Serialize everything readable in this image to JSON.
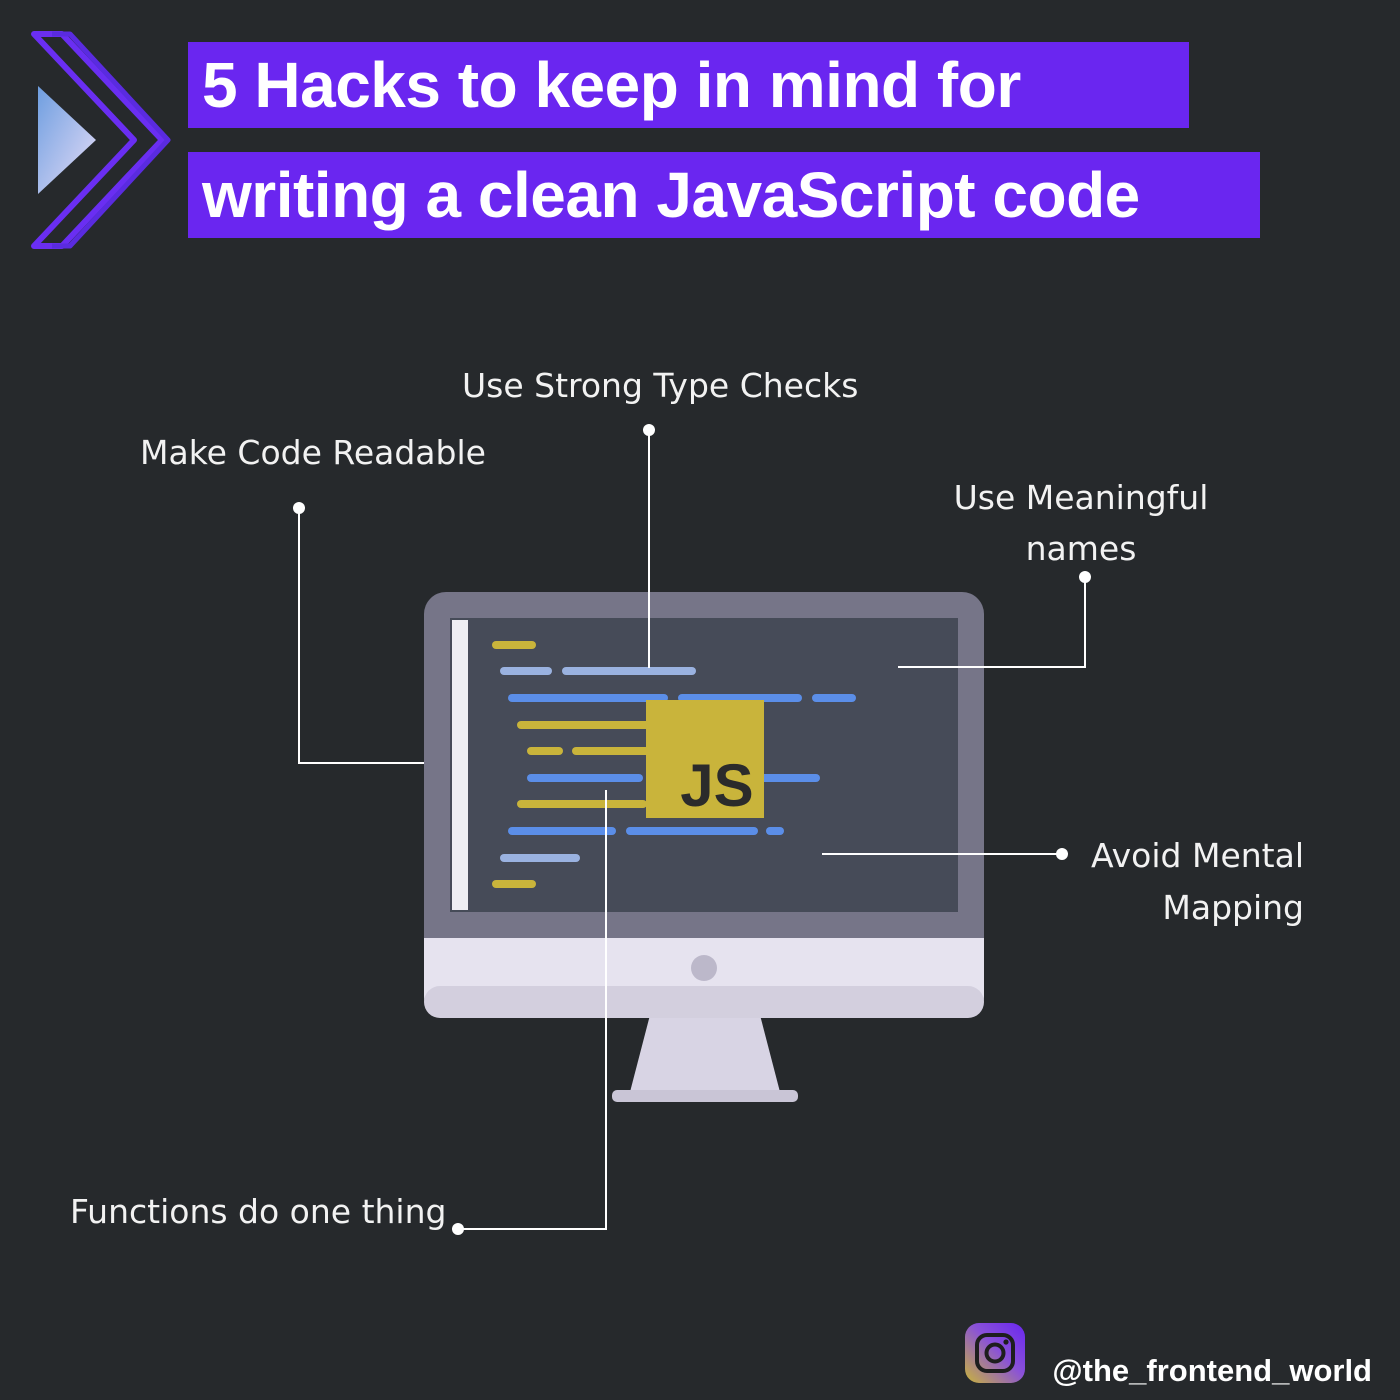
{
  "title": {
    "line1": "5 Hacks to keep in mind for",
    "line2": "writing a clean JavaScript code"
  },
  "hacks": {
    "readable": "Make Code Readable",
    "type_checks": "Use Strong Type Checks",
    "meaningful_names": "Use Meaningful names",
    "mental_mapping": "Avoid Mental Mapping",
    "functions": "Functions do one thing"
  },
  "monitor": {
    "badge_text": "JS"
  },
  "footer": {
    "handle": "@the_frontend_world",
    "icon": "instagram-icon"
  },
  "colors": {
    "background": "#26292c",
    "title_highlight": "#6a26f0",
    "js_yellow": "#c9b43b",
    "code_blue": "#5b8ee8"
  }
}
